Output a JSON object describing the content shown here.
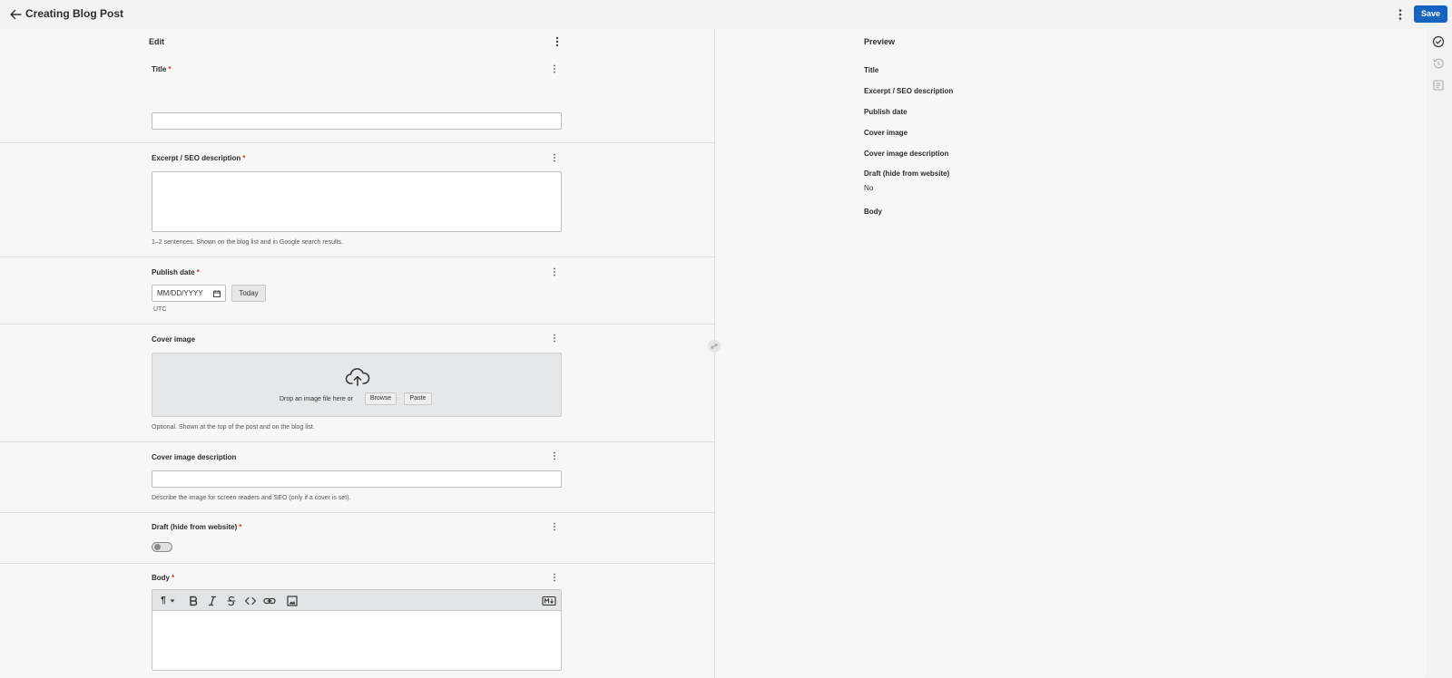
{
  "header": {
    "title": "Creating Blog Post",
    "save_label": "Save",
    "accent_color": "#1565c0"
  },
  "edit_pane": {
    "heading": "Edit",
    "fields": {
      "title": {
        "label": "Title",
        "required_mark": "*",
        "value": ""
      },
      "excerpt": {
        "label": "Excerpt / SEO description",
        "required_mark": "*",
        "value": "",
        "help": "1–2 sentences. Shown on the blog list and in Google search results."
      },
      "publish_date": {
        "label": "Publish date",
        "required_mark": "*",
        "placeholder": "MM/DD/YYYY",
        "today_label": "Today",
        "timezone": "UTC"
      },
      "cover_image": {
        "label": "Cover image",
        "drop_text": "Drop an image file here or",
        "browse_label": "Browse",
        "paste_label": "Paste",
        "help": "Optional. Shown at the top of the post and on the blog list."
      },
      "cover_image_description": {
        "label": "Cover image description",
        "value": "",
        "help": "Describe the image for screen readers and SEO (only if a cover is set)."
      },
      "draft": {
        "label": "Draft (hide from website)",
        "required_mark": "*",
        "checked": false
      },
      "body": {
        "label": "Body",
        "required_mark": "*",
        "paragraph_symbol": "¶",
        "value": ""
      }
    }
  },
  "preview_pane": {
    "heading": "Preview",
    "items": [
      {
        "label": "Title",
        "value": ""
      },
      {
        "label": "Excerpt / SEO description",
        "value": ""
      },
      {
        "label": "Publish date",
        "value": ""
      },
      {
        "label": "Cover image",
        "value": ""
      },
      {
        "label": "Cover image description",
        "value": ""
      },
      {
        "label": "Draft (hide from website)",
        "value": "No"
      },
      {
        "label": "Body",
        "value": ""
      }
    ]
  },
  "side_icons": [
    "check-circle-icon",
    "history-icon",
    "document-list-icon"
  ]
}
